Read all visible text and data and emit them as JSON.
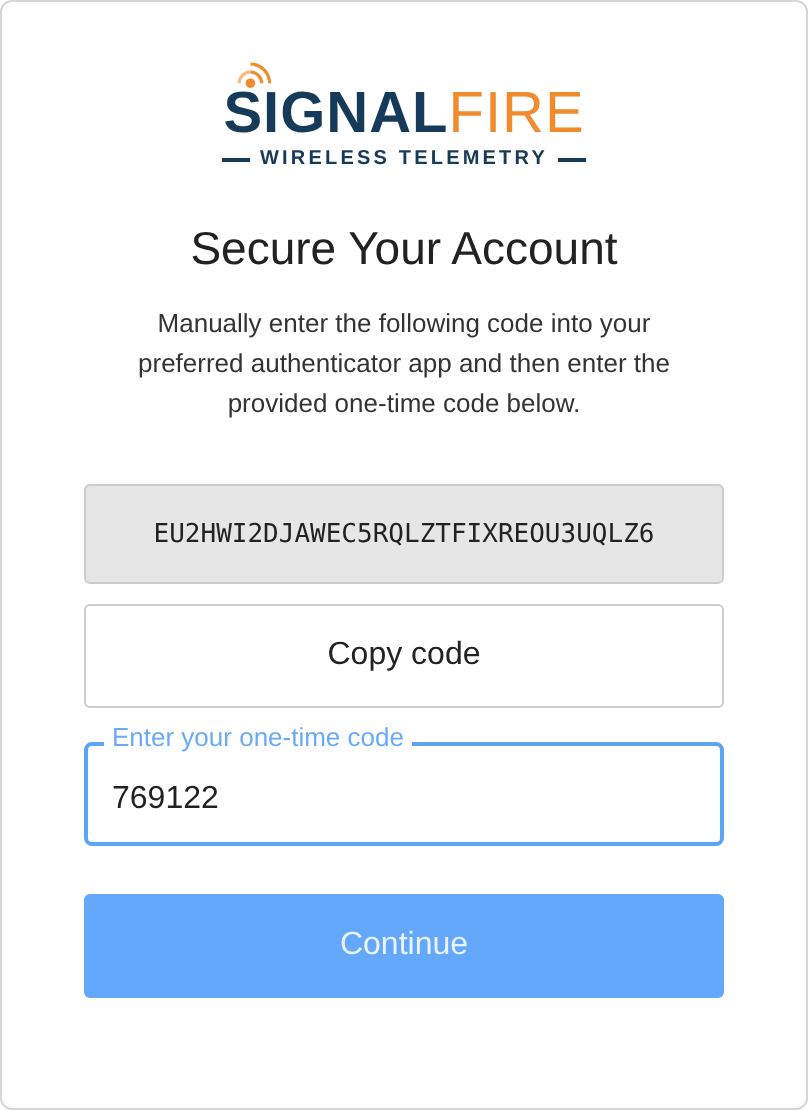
{
  "logo": {
    "name_part_1": "SIGNAL",
    "name_part_2": "FIRE",
    "tagline": "WIRELESS TELEMETRY"
  },
  "title": "Secure Your Account",
  "instructions": "Manually enter the following code into your preferred authenticator app and then enter the provided one-time code below.",
  "secret_code": "EU2HWI2DJAWEC5RQLZTFIXREOU3UQLZ6",
  "copy_button": "Copy code",
  "otp_field": {
    "label": "Enter your one-time code",
    "value": "769122",
    "focused": true
  },
  "continue_button": {
    "label": "Continue",
    "disabled": true
  }
}
